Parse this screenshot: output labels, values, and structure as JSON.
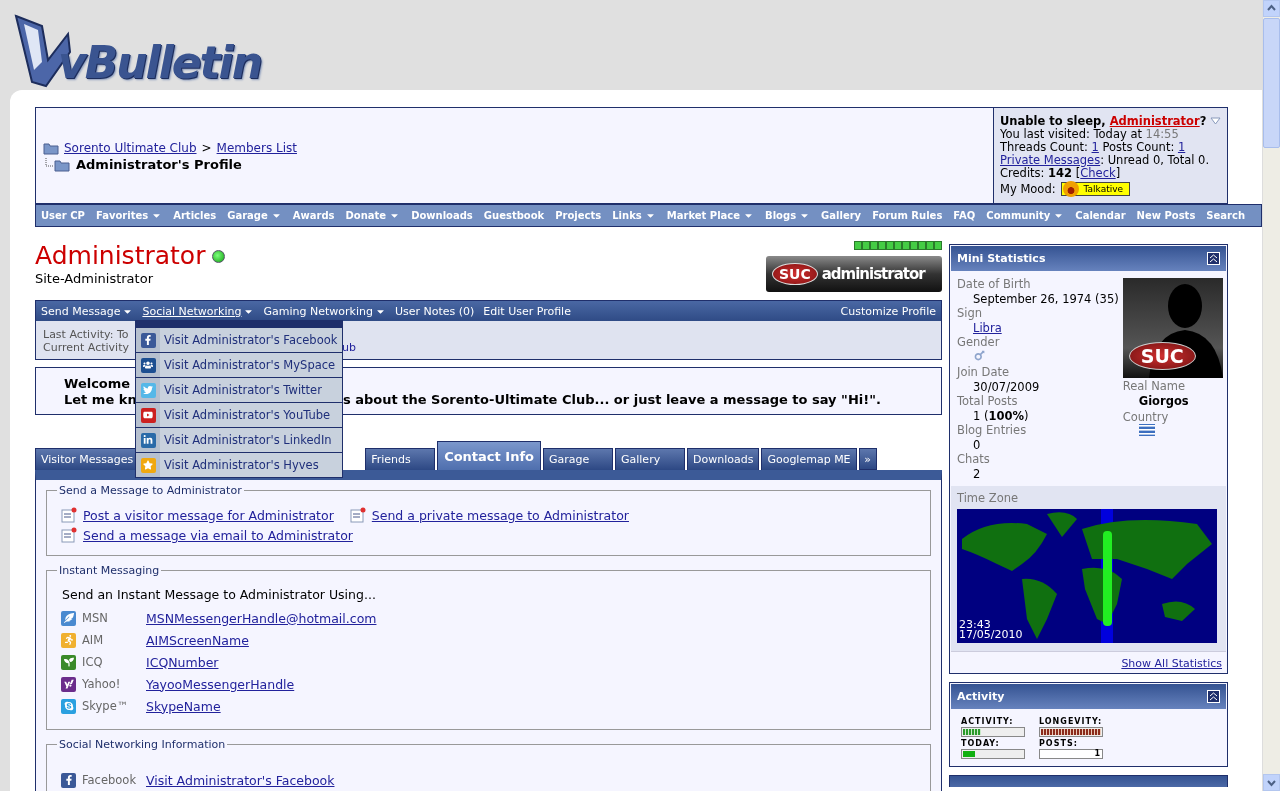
{
  "logo": {
    "text": "vBulletin"
  },
  "breadcrumb": {
    "links": [
      "Sorento Ultimate Club",
      "Members List"
    ],
    "separator": ">",
    "current": "Administrator's Profile"
  },
  "user_box": {
    "greeting": "Unable to sleep, ",
    "user": "Administrator",
    "greeting_end": "?",
    "visited_label": "You last visited: Today at ",
    "visited_time": "14:55",
    "threads_label": "Threads Count: ",
    "threads": "1",
    "posts_label": " Posts Count: ",
    "posts": "1",
    "pm_link": "Private Messages",
    "pm_text": ": Unread 0, Total 0.",
    "credits_label": "Credits: ",
    "credits": "142",
    "bracket_open": " [",
    "check": "Check",
    "bracket_close": "]",
    "mood_label": "My Mood:",
    "mood": "Talkative"
  },
  "navbar": [
    {
      "label": "User CP",
      "dropdown": false
    },
    {
      "label": "Favorites",
      "dropdown": true
    },
    {
      "label": "Articles",
      "dropdown": false
    },
    {
      "label": "Garage",
      "dropdown": true
    },
    {
      "label": "Awards",
      "dropdown": false
    },
    {
      "label": "Donate",
      "dropdown": true
    },
    {
      "label": "Downloads",
      "dropdown": false
    },
    {
      "label": "Guestbook",
      "dropdown": false
    },
    {
      "label": "Projects",
      "dropdown": false
    },
    {
      "label": "Links",
      "dropdown": true
    },
    {
      "label": "Market Place",
      "dropdown": true
    },
    {
      "label": "Blogs",
      "dropdown": true
    },
    {
      "label": "Gallery",
      "dropdown": false
    },
    {
      "label": "Forum Rules",
      "dropdown": false
    },
    {
      "label": "FAQ",
      "dropdown": false
    },
    {
      "label": "Community",
      "dropdown": true
    },
    {
      "label": "Calendar",
      "dropdown": false
    },
    {
      "label": "New Posts",
      "dropdown": false
    },
    {
      "label": "Search",
      "dropdown": false
    }
  ],
  "profile": {
    "name": "Administrator",
    "online": true,
    "title": "Site-Administrator",
    "rank_logo": "SUC",
    "rank_text": "administrator"
  },
  "profile_menu": {
    "items": [
      {
        "label": "Send Message",
        "kind": "menu",
        "expanded": false
      },
      {
        "label": "Social Networking",
        "kind": "menu",
        "expanded": true
      },
      {
        "label": "Gaming Networking",
        "kind": "menu",
        "expanded": false
      },
      {
        "label": "User Notes (0)",
        "kind": "link"
      },
      {
        "label": "Edit User Profile",
        "kind": "link"
      }
    ],
    "right": "Customize Profile",
    "last_activity": "Last Activity: To",
    "current_activity": "Current Activity",
    "current_tail": "ub"
  },
  "social_dropdown": [
    {
      "kind": "facebook",
      "label": "Visit Administrator's Facebook"
    },
    {
      "kind": "myspace",
      "label": "Visit Administrator's MySpace"
    },
    {
      "kind": "twitter",
      "label": "Visit Administrator's Twitter"
    },
    {
      "kind": "youtube",
      "label": "Visit Administrator's YouTube"
    },
    {
      "kind": "linkedin",
      "label": "Visit Administrator's LinkedIn"
    },
    {
      "kind": "hyves",
      "label": "Visit Administrator's Hyves"
    }
  ],
  "welcome": {
    "line1": "Welcome",
    "line2_start": "Let me kn",
    "line2_end": "s about the Sorento-Ultimate Club... or just leave a message to say \"Hi!\"."
  },
  "tabs": [
    {
      "label": "Visitor Messages",
      "selected": false
    },
    {
      "label": "Friends",
      "selected": false
    },
    {
      "label": "Contact Info",
      "selected": true
    },
    {
      "label": "Garage",
      "selected": false
    },
    {
      "label": "Gallery",
      "selected": false
    },
    {
      "label": "Downloads",
      "selected": false
    },
    {
      "label": "Googlemap ME",
      "selected": false
    }
  ],
  "more_tabs": "»",
  "send_message": {
    "title": "Send a Message to Administrator",
    "links": [
      "Post a visitor message for Administrator",
      "Send a private message to Administrator",
      "Send a message via email to Administrator"
    ]
  },
  "instant_messaging": {
    "title": "Instant Messaging",
    "intro": "Send an Instant Message to Administrator Using...",
    "rows": [
      {
        "kind": "msn",
        "service": "MSN",
        "handle": "MSNMessengerHandle@hotmail.com"
      },
      {
        "kind": "aim",
        "service": "AIM",
        "handle": "AIMScreenName"
      },
      {
        "kind": "icq",
        "service": "ICQ",
        "handle": "ICQNumber"
      },
      {
        "kind": "yahoo",
        "service": "Yahoo!",
        "handle": "YayooMessengerHandle"
      },
      {
        "kind": "skype",
        "service": "Skype™",
        "handle": "SkypeName"
      }
    ]
  },
  "social_info": {
    "title": "Social Networking Information",
    "rows": [
      {
        "kind": "facebook",
        "service": "Facebook",
        "handle": "Visit Administrator's Facebook"
      }
    ]
  },
  "mini_stats": {
    "title": "Mini Statistics",
    "fields": [
      {
        "label": "Date of Birth",
        "kind": "text",
        "value": "September 26, 1974 (35)"
      },
      {
        "label": "Sign",
        "kind": "link",
        "value": "Libra"
      },
      {
        "label": "Gender",
        "kind": "gender"
      },
      {
        "label": "Join Date",
        "kind": "text",
        "value": "30/07/2009"
      },
      {
        "label": "Total Posts",
        "kind": "text",
        "value": "1 (**100%**)"
      },
      {
        "label": "Blog Entries",
        "kind": "text",
        "value": "0"
      },
      {
        "label": "Chats",
        "kind": "text",
        "value": "2"
      }
    ],
    "avatar_logo": "SUC",
    "real_name_label": "Real Name",
    "real_name": "Giorgos",
    "country_label": "Country",
    "timezone_label": "Time Zone",
    "time": "23:43",
    "date": "17/05/2010",
    "show_all": "Show All Statistics"
  },
  "activity": {
    "title": "Activity",
    "meters": [
      {
        "label": "ACTIVITY:",
        "kind": "meter",
        "level": 0.3
      },
      {
        "label": "LONGEVITY:",
        "kind": "meter",
        "level": 1
      },
      {
        "label": "TODAY:",
        "kind": "blocks",
        "level": 0.2
      },
      {
        "label": "POSTS:",
        "kind": "count",
        "value": "1"
      }
    ]
  }
}
